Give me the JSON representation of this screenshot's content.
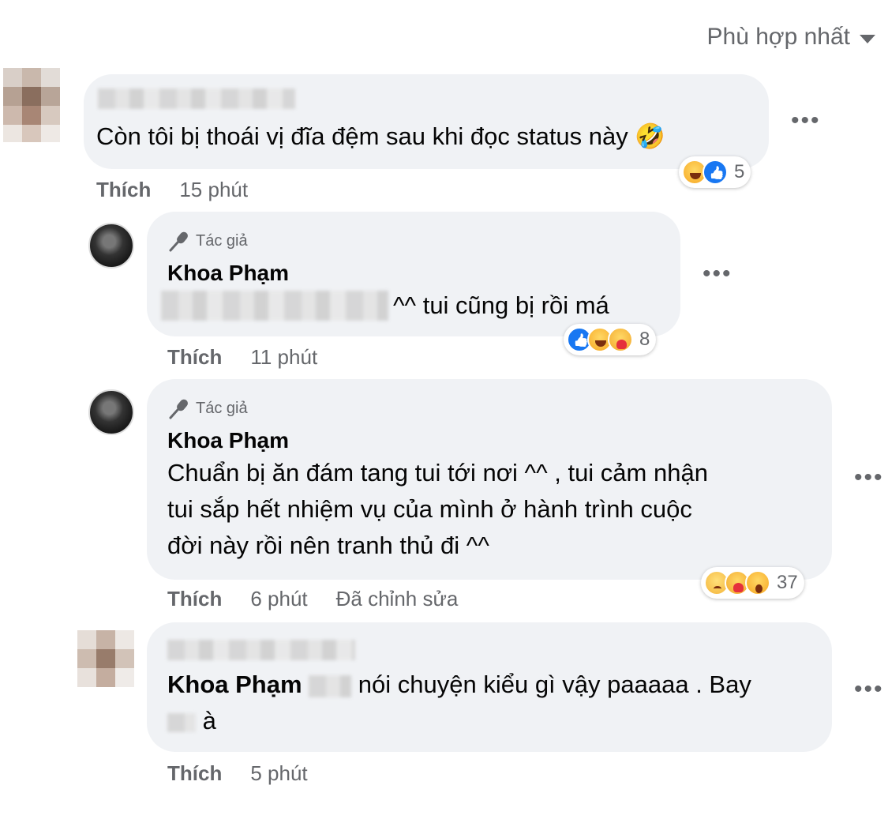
{
  "sort": {
    "label": "Phù hợp nhất"
  },
  "comments": [
    {
      "text": "Còn tôi bị thoái vị đĩa đệm sau khi đọc status này 🤣",
      "like_label": "Thích",
      "time": "15 phút",
      "reaction_icons": [
        "haha-icon",
        "like-icon"
      ],
      "reaction_count": "5"
    },
    {
      "author_badge": "Tác giả",
      "name": "Khoa Phạm",
      "text": "^^ tui cũng bị rồi má",
      "like_label": "Thích",
      "time": "11 phút",
      "reaction_icons": [
        "like-icon",
        "haha-icon",
        "care-icon"
      ],
      "reaction_count": "8"
    },
    {
      "author_badge": "Tác giả",
      "name": "Khoa Phạm",
      "text_lines": [
        "Chuẩn bị ăn đám tang tui tới nơi ^^ , tui cảm nhận",
        "tui sắp hết nhiệm vụ của mình ở hành trình cuộc",
        "đời này rồi nên tranh thủ đi ^^"
      ],
      "like_label": "Thích",
      "time": "6 phút",
      "edited": "Đã chỉnh sửa",
      "reaction_icons": [
        "sad-icon",
        "care-icon",
        "wow-icon"
      ],
      "reaction_count": "37"
    },
    {
      "mention": "Khoa Phạm",
      "text_line1": "nói chuyện kiểu gì vậy paaaaa . Bay",
      "text_line2": "à",
      "like_label": "Thích",
      "time": "5 phút"
    }
  ],
  "colors": {
    "bubble": "#f0f2f5",
    "meta": "#65676b",
    "text": "#050505",
    "like_blue": "#1877f2"
  }
}
